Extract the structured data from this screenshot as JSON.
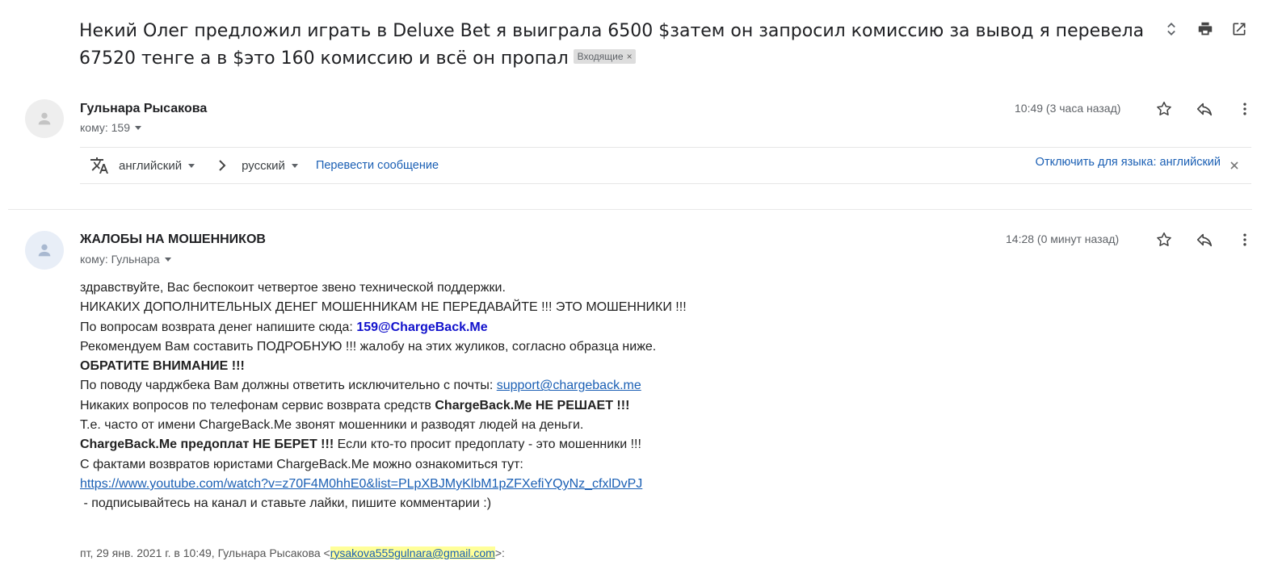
{
  "thread": {
    "subject": "Некий Олег предложил играть в Deluxe Bet я выиграла 6500 $затем он запросил комиссию за вывод я перевела 67520 тенге а в $это 160 комиссию и всё он пропал",
    "label": "Входящие",
    "label_remove": "×"
  },
  "messages": [
    {
      "sender": "Гульнара Рысакова",
      "to": "кому: 159",
      "time": "10:49 (3 часа назад)"
    },
    {
      "sender": "ЖАЛОБЫ НА МОШЕННИКОВ",
      "to": "кому: Гульнара",
      "time": "14:28 (0 минут назад)"
    }
  ],
  "translate": {
    "from_lang": "английский",
    "to_lang": "русский",
    "translate_link": "Перевести сообщение",
    "disable_link": "Отключить для языка: английский"
  },
  "body": {
    "l1": "здравствуйте, Вас беспокоит четвертое звено технической поддержки.",
    "l2": "НИКАКИХ ДОПОЛНИТЕЛЬНЫХ ДЕНЕГ МОШЕННИКАМ НЕ ПЕРЕДАВАЙТЕ !!! ЭТО МОШЕННИКИ !!!",
    "l3_pre": "По вопросам возврата денег напишите сюда: ",
    "l3_email": "159@ChargeBack.Me",
    "l4": "Рекомендуем Вам составить ПОДРОБНУЮ !!! жалобу на этих жуликов, согласно образца ниже.",
    "l5": "ОБРАТИТЕ ВНИМАНИЕ !!!",
    "l6_pre": "По поводу чарджбека Вам должны ответить исключительно с почты: ",
    "l6_link": "support@chargeback.me",
    "l7_pre": "Никаких вопросов по телефонам сервис возврата средств ",
    "l7_bold": "ChargeBack.Me НЕ РЕШАЕТ !!!",
    "l8": "Т.е. часто от имени ChargeBack.Me звонят мошенники и разводят людей на деньги.",
    "l9_bold": "ChargeBack.Me предоплат НЕ БЕРЕТ !!!",
    "l9_post": " Если кто-то просит предоплату - это мошенники !!!",
    "l10": "С фактами возвратов юристами ChargeBack.Me можно ознакомиться тут:",
    "l11_link": "https://www.youtube.com/watch?v=z70F4M0hhE0&list=PLpXBJMyKlbM1pZFXefiYQyNz_cfxlDvPJ",
    "l12_dash": " - ",
    "l12": "подписывайтесь на канал и ставьте лайки, пишите комментарии :)"
  },
  "quote": {
    "prefix": "пт, 29 янв. 2021 г. в 10:49, Гульнара Рысакова <",
    "email": "rysakova555gulnara@gmail.com",
    "suffix": ">:"
  },
  "icons": {
    "expand": "unfold-icon",
    "print": "print-icon",
    "open_new": "open-in-new-window-icon",
    "avatar": "person-icon",
    "star": "star-icon",
    "reply": "reply-icon",
    "more": "more-vert-icon",
    "translate": "translate-icon"
  }
}
